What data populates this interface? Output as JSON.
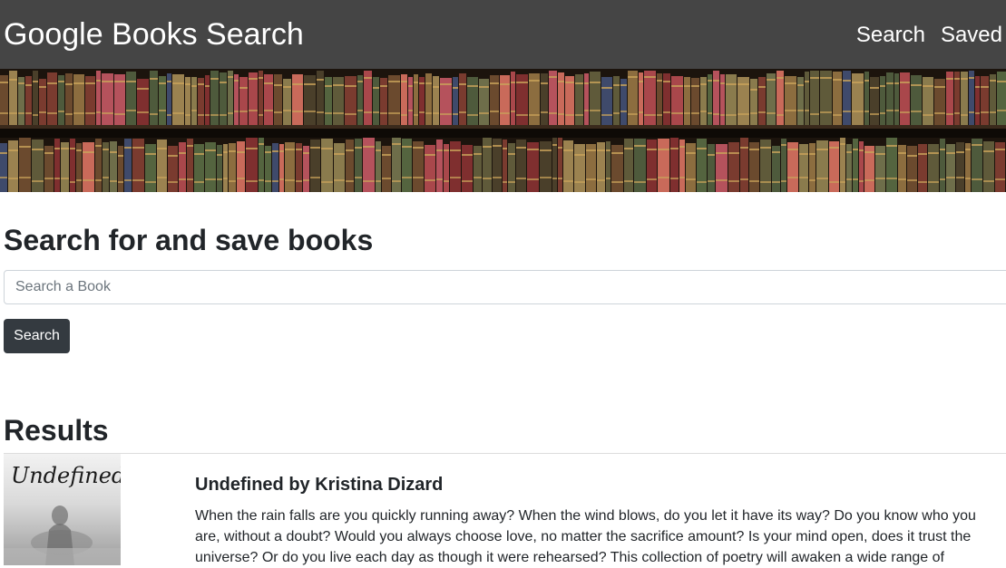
{
  "navbar": {
    "brand": "Google Books Search",
    "links": [
      {
        "label": "Search"
      },
      {
        "label": "Saved"
      }
    ]
  },
  "main": {
    "title": "Search for and save books",
    "search": {
      "placeholder": "Search a Book",
      "value": "",
      "button_label": "Search"
    },
    "results_title": "Results",
    "results": [
      {
        "heading": "Undefined by Kristina Dizard",
        "cover_text": "Undefined",
        "description": "When the rain falls are you quickly running away? When the wind blows, do you let it have its way? Do you know who you are, without a doubt? Would you always choose love, no matter the sacrifice amount? Is your mind open, does it trust the universe? Or do you live each day as though it were rehearsed? This collection of poetry will awaken a wide range of"
      }
    ]
  }
}
